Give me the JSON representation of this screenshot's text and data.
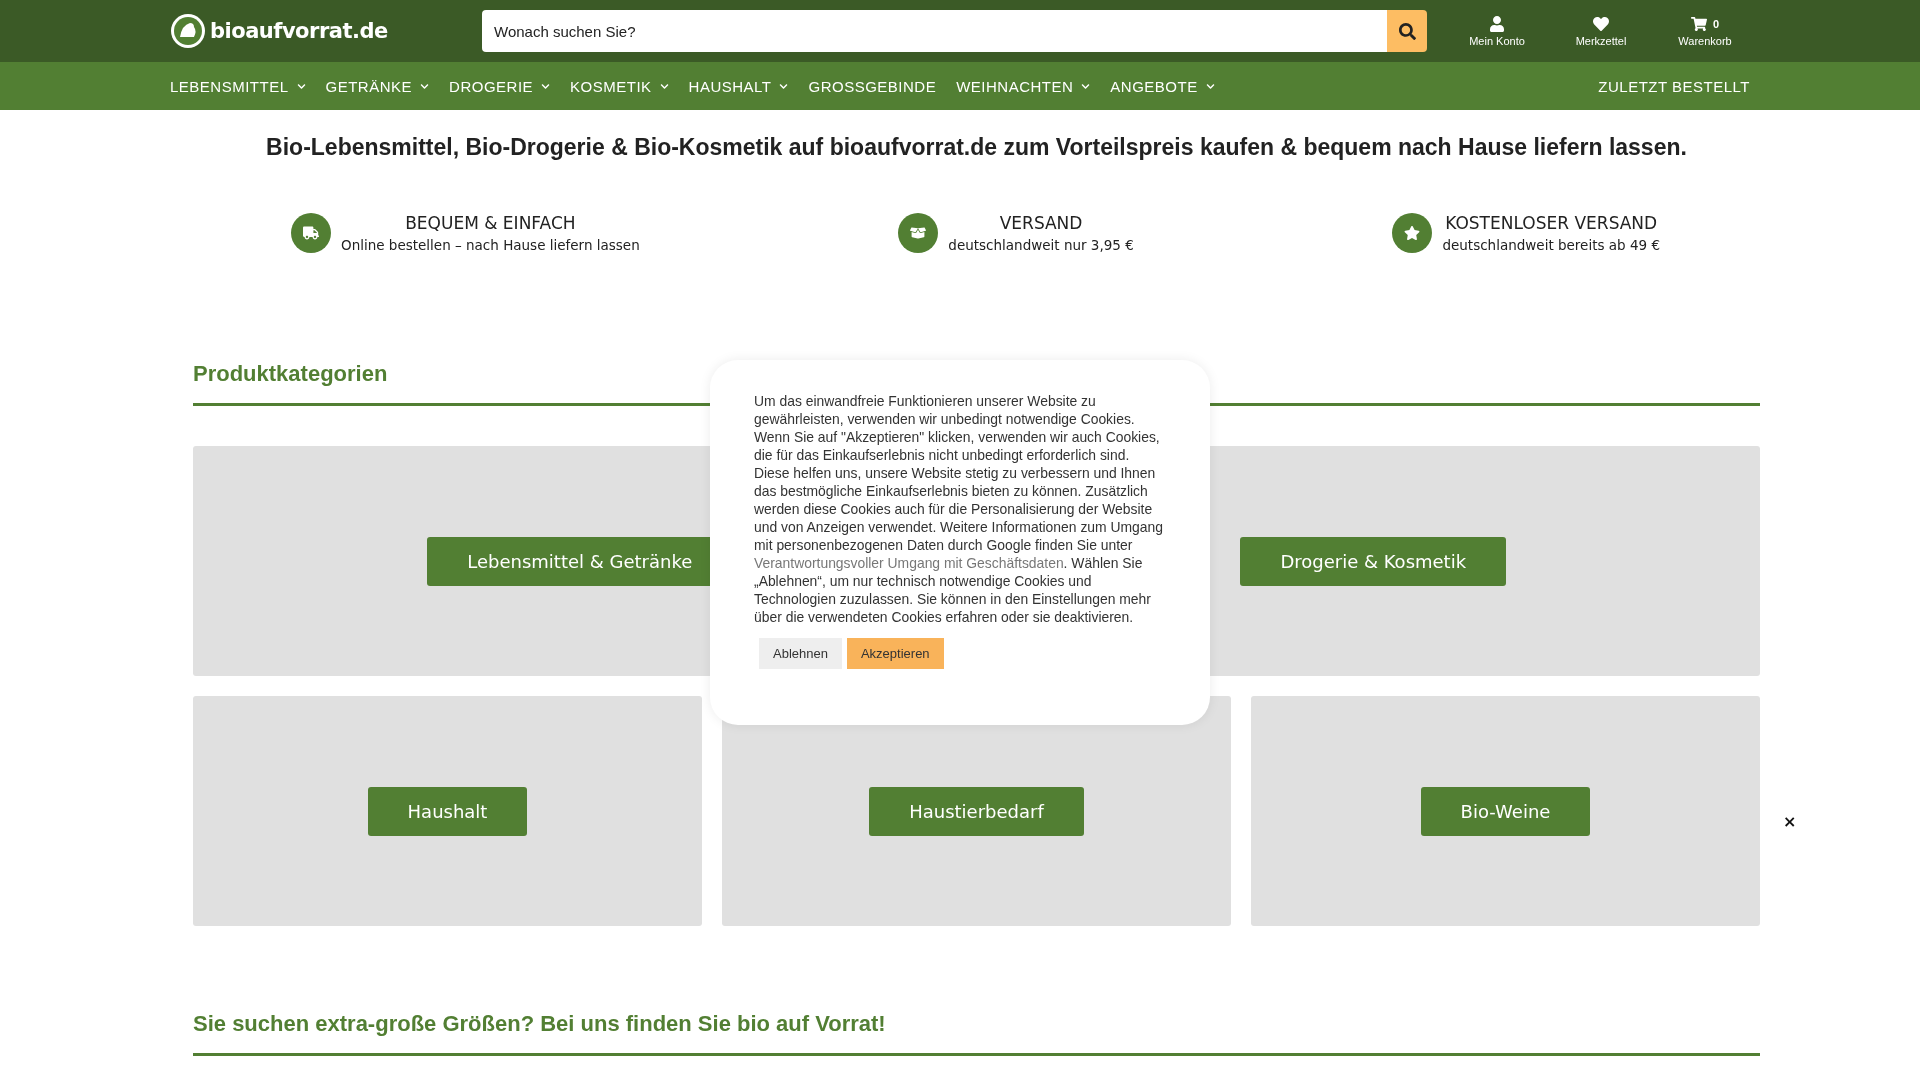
{
  "header": {
    "logo": "bioaufvorrat.de",
    "search": {
      "placeholder": "Wonach suchen Sie?"
    },
    "actions": [
      {
        "kind": "account",
        "label": "Mein Konto"
      },
      {
        "kind": "wishlist",
        "label": "Merkzettel"
      },
      {
        "kind": "cart",
        "label": "Warenkorb",
        "count": "0"
      }
    ]
  },
  "nav": {
    "items": [
      {
        "label": "LEBENSMITTEL",
        "dropdown": true
      },
      {
        "label": "GETRÄNKE",
        "dropdown": true
      },
      {
        "label": "DROGERIE",
        "dropdown": true
      },
      {
        "label": "KOSMETIK",
        "dropdown": true
      },
      {
        "label": "HAUSHALT",
        "dropdown": true
      },
      {
        "label": "GROSSGEBINDE",
        "dropdown": false
      },
      {
        "label": "WEIHNACHTEN",
        "dropdown": true
      },
      {
        "label": "ANGEBOTE",
        "dropdown": true
      }
    ],
    "right": "ZULETZT BESTELLT"
  },
  "headline": "Bio-Lebensmittel, Bio-Drogerie & Bio-Kosmetik auf bioaufvorrat.de zum Vorteilspreis kaufen & bequem nach Hause liefern lassen.",
  "features": [
    {
      "kind": "truck",
      "title": "BEQUEM & EINFACH",
      "text": "Online bestellen – nach Hause liefern lassen"
    },
    {
      "kind": "box",
      "title": "VERSAND",
      "text": "deutschlandweit nur 3,95 €"
    },
    {
      "kind": "star",
      "title": "KOSTENLOSER VERSAND",
      "text": "deutschlandweit bereits ab 49 €"
    }
  ],
  "categories": {
    "title": "Produktkategorien",
    "rows": [
      [
        "Lebensmittel & Getränke",
        "Drogerie & Kosmetik"
      ],
      [
        "Haushalt",
        "Haustierbedarf",
        "Bio-Weine"
      ]
    ]
  },
  "section2": {
    "title": "Sie suchen extra-große Größen? Bei uns finden Sie bio auf Vorrat!"
  },
  "close_mark": "×",
  "cookie": {
    "text_before": "Um das einwandfreie Funktionieren unserer Website zu gewährleisten, verwenden wir unbedingt notwendige Cookies. Wenn Sie auf \"Akzeptieren\" klicken, verwenden wir auch Cookies, die für das Einkaufserlebnis nicht unbedingt erforderlich sind. Diese helfen uns, unsere Website stetig zu verbessern und Ihnen das bestmögliche Einkaufserlebnis bieten zu können. Zusätzlich werden diese Cookies auch für die Personalisierung der Website und von Anzeigen verwendet. Weitere Informationen zum Umgang mit personenbezogenen Daten durch Google finden Sie unter ",
    "link": "Verantwortungsvoller Umgang mit Geschäftsdaten",
    "text_after": ". Wählen Sie „Ablehnen“, um nur technisch notwendige Cookies und Technologien zuzulassen. Sie können in den Einstellungen mehr über die verwendeten Cookies erfahren oder sie deaktivieren.",
    "buttons": [
      {
        "kind": "secondary",
        "label": "Ablehnen"
      },
      {
        "kind": "primary",
        "label": "Akzeptieren"
      }
    ]
  }
}
